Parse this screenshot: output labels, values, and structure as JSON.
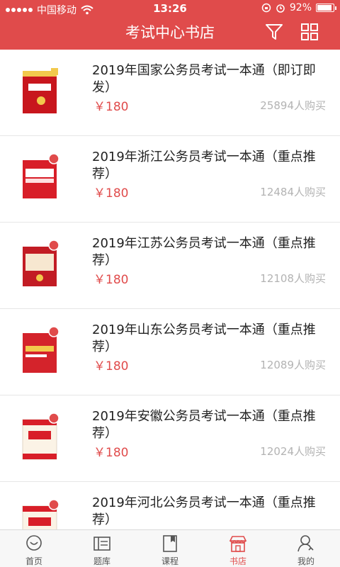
{
  "status": {
    "carrier": "中国移动",
    "time": "13:26",
    "battery": "92%",
    "battery_level": 0.92
  },
  "nav": {
    "title": "考试中心书店",
    "filter_icon": "filter-icon",
    "grid_icon": "grid-icon"
  },
  "colors": {
    "brand": "#e04b4b",
    "muted": "#b3b3b3"
  },
  "books": [
    {
      "title": "2019年国家公务员考试一本通（即订即发）",
      "price": "￥180",
      "sold": "25894人购买"
    },
    {
      "title": "2019年浙江公务员考试一本通（重点推荐）",
      "price": "￥180",
      "sold": "12484人购买"
    },
    {
      "title": "2019年江苏公务员考试一本通（重点推荐）",
      "price": "￥180",
      "sold": "12108人购买"
    },
    {
      "title": "2019年山东公务员考试一本通（重点推荐）",
      "price": "￥180",
      "sold": "12089人购买"
    },
    {
      "title": "2019年安徽公务员考试一本通（重点推荐）",
      "price": "￥180",
      "sold": "12024人购买"
    },
    {
      "title": "2019年河北公务员考试一本通（重点推荐）",
      "price": "",
      "sold": ""
    }
  ],
  "tabs": [
    {
      "label": "首页",
      "icon": "home-chat-icon"
    },
    {
      "label": "题库",
      "icon": "question-bank-icon"
    },
    {
      "label": "课程",
      "icon": "course-book-icon"
    },
    {
      "label": "书店",
      "icon": "store-icon",
      "active": true
    },
    {
      "label": "我的",
      "icon": "user-icon"
    }
  ]
}
